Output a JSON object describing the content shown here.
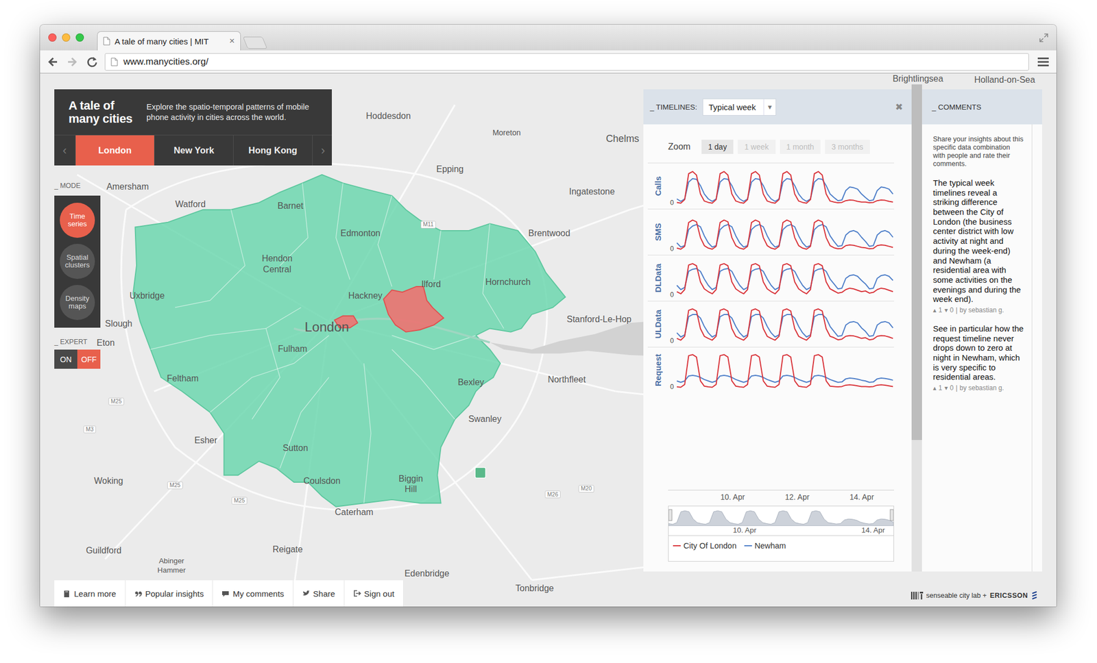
{
  "browser": {
    "tab": {
      "title": "A tale of many cities | MIT",
      "close": "×",
      "selected": true
    },
    "url": "www.manycities.org/"
  },
  "header": {
    "title": "A tale of many cities",
    "description": "Explore the spatio-temporal patterns of mobile phone activity in cities across the world.",
    "prev": "‹",
    "next": "›",
    "cities": [
      {
        "label": "London",
        "selected": true
      },
      {
        "label": "New York",
        "selected": false
      },
      {
        "label": "Hong Kong",
        "selected": false
      }
    ]
  },
  "mode": {
    "label": "_ MODE",
    "items": [
      {
        "label": "Time series",
        "selected": true
      },
      {
        "label": "Spatial clusters",
        "selected": false
      },
      {
        "label": "Density maps",
        "selected": false
      }
    ]
  },
  "expert": {
    "label": "_ EXPERT",
    "options": [
      {
        "label": "ON",
        "selected": false
      },
      {
        "label": "OFF",
        "selected": true
      }
    ]
  },
  "map": {
    "labels": [
      {
        "text": "Brightlingsea",
        "kind": "place"
      },
      {
        "text": "Holland-on-Sea",
        "kind": "place"
      },
      {
        "text": "Hoddesdon",
        "kind": "place"
      },
      {
        "text": "Moreton",
        "kind": "place"
      },
      {
        "text": "Chelms",
        "kind": "place"
      },
      {
        "text": "Epping",
        "kind": "place"
      },
      {
        "text": "Ingatestone",
        "kind": "place"
      },
      {
        "text": "Amersham",
        "kind": "place"
      },
      {
        "text": "Watford",
        "kind": "place"
      },
      {
        "text": "Barnet",
        "kind": "place"
      },
      {
        "text": "Edmonton",
        "kind": "place"
      },
      {
        "text": "Brentwood",
        "kind": "place"
      },
      {
        "text": "Hendon",
        "kind": "place"
      },
      {
        "text": "Central",
        "kind": "place"
      },
      {
        "text": "Hackney",
        "kind": "place"
      },
      {
        "text": "Ilford",
        "kind": "place"
      },
      {
        "text": "Hornchurch",
        "kind": "place"
      },
      {
        "text": "Uxbridge",
        "kind": "place"
      },
      {
        "text": "Slough",
        "kind": "place"
      },
      {
        "text": "London",
        "kind": "city"
      },
      {
        "text": "Stanford-Le-Hop",
        "kind": "place"
      },
      {
        "text": "Eton",
        "kind": "place"
      },
      {
        "text": "Fulham",
        "kind": "place"
      },
      {
        "text": "Feltham",
        "kind": "place"
      },
      {
        "text": "Bexley",
        "kind": "place"
      },
      {
        "text": "Northfleet",
        "kind": "place"
      },
      {
        "text": "Swanley",
        "kind": "place"
      },
      {
        "text": "Esher",
        "kind": "place"
      },
      {
        "text": "Sutton",
        "kind": "place"
      },
      {
        "text": "Woking",
        "kind": "place"
      },
      {
        "text": "Coulsdon",
        "kind": "place"
      },
      {
        "text": "Biggin",
        "kind": "place"
      },
      {
        "text": "Hill",
        "kind": "place"
      },
      {
        "text": "Caterham",
        "kind": "place"
      },
      {
        "text": "Reigate",
        "kind": "place"
      },
      {
        "text": "Guildford",
        "kind": "place"
      },
      {
        "text": "Abinger",
        "kind": "place"
      },
      {
        "text": "Hammer",
        "kind": "place"
      },
      {
        "text": "Edenbridge",
        "kind": "place"
      },
      {
        "text": "Tonbridge",
        "kind": "place"
      },
      {
        "text": "M11",
        "kind": "road"
      },
      {
        "text": "M25",
        "kind": "road"
      },
      {
        "text": "M3",
        "kind": "road"
      },
      {
        "text": "M25",
        "kind": "road"
      },
      {
        "text": "M25",
        "kind": "road"
      },
      {
        "text": "M20",
        "kind": "road"
      },
      {
        "text": "M26",
        "kind": "road"
      }
    ]
  },
  "timelines": {
    "label": "_ TIMELINES:",
    "dropdown": {
      "value": "Typical week",
      "arrow": "▾"
    },
    "close": "✖",
    "zoom": {
      "label": "Zoom",
      "options": [
        {
          "label": "1 day",
          "selected": true,
          "disabled": false
        },
        {
          "label": "1 week",
          "selected": false,
          "disabled": true
        },
        {
          "label": "1 month",
          "selected": false,
          "disabled": true
        },
        {
          "label": "3 months",
          "selected": false,
          "disabled": true
        }
      ]
    },
    "y_tick": "0",
    "charts": [
      {
        "metric": "Calls",
        "values": [
          [
            4,
            2,
            12,
            86,
            92,
            82,
            28,
            8,
            4,
            2,
            12,
            86,
            92,
            82,
            28,
            8,
            4,
            2,
            12,
            86,
            92,
            82,
            28,
            8,
            4,
            2,
            12,
            86,
            92,
            82,
            28,
            8,
            4,
            2,
            12,
            86,
            92,
            82,
            28,
            8,
            5,
            3,
            4,
            9,
            11,
            10,
            7,
            5,
            5,
            3,
            4,
            9,
            11,
            10,
            7,
            5
          ],
          [
            14,
            7,
            14,
            62,
            72,
            70,
            52,
            28,
            14,
            7,
            14,
            62,
            72,
            70,
            52,
            28,
            14,
            7,
            14,
            62,
            72,
            70,
            52,
            28,
            14,
            7,
            14,
            62,
            72,
            70,
            52,
            28,
            14,
            7,
            14,
            62,
            72,
            70,
            52,
            28,
            18,
            9,
            11,
            38,
            48,
            46,
            42,
            28,
            18,
            9,
            11,
            38,
            48,
            46,
            42,
            28
          ]
        ]
      },
      {
        "metric": "SMS",
        "values": [
          [
            5,
            2,
            10,
            78,
            85,
            80,
            35,
            12,
            5,
            2,
            10,
            78,
            85,
            80,
            35,
            12,
            5,
            2,
            10,
            78,
            85,
            80,
            35,
            12,
            5,
            2,
            10,
            78,
            85,
            80,
            35,
            12,
            5,
            2,
            10,
            78,
            85,
            80,
            35,
            12,
            6,
            3,
            4,
            12,
            14,
            13,
            10,
            7,
            6,
            3,
            4,
            12,
            14,
            13,
            10,
            7
          ],
          [
            20,
            8,
            12,
            58,
            68,
            72,
            66,
            40,
            20,
            8,
            12,
            58,
            68,
            72,
            66,
            40,
            20,
            8,
            12,
            58,
            68,
            72,
            66,
            40,
            20,
            8,
            12,
            58,
            68,
            72,
            66,
            40,
            20,
            8,
            12,
            58,
            68,
            72,
            66,
            40,
            24,
            10,
            12,
            42,
            52,
            55,
            50,
            36,
            24,
            10,
            12,
            42,
            52,
            55,
            50,
            36
          ]
        ]
      },
      {
        "metric": "DLData",
        "values": [
          [
            12,
            6,
            18,
            88,
            92,
            86,
            40,
            20,
            12,
            6,
            18,
            88,
            92,
            86,
            40,
            20,
            12,
            6,
            18,
            88,
            92,
            86,
            40,
            20,
            12,
            6,
            18,
            88,
            92,
            86,
            40,
            20,
            12,
            6,
            18,
            88,
            92,
            86,
            40,
            20,
            14,
            8,
            10,
            18,
            22,
            20,
            16,
            12,
            14,
            8,
            10,
            18,
            22,
            20,
            16,
            12
          ],
          [
            30,
            18,
            24,
            70,
            76,
            78,
            70,
            48,
            30,
            18,
            24,
            70,
            76,
            78,
            70,
            48,
            30,
            18,
            24,
            70,
            76,
            78,
            70,
            48,
            30,
            18,
            24,
            70,
            76,
            78,
            70,
            48,
            30,
            18,
            24,
            70,
            76,
            78,
            70,
            48,
            34,
            20,
            22,
            50,
            58,
            60,
            56,
            44,
            34,
            20,
            22,
            50,
            58,
            60,
            56,
            44
          ]
        ]
      },
      {
        "metric": "ULData",
        "values": [
          [
            10,
            5,
            16,
            90,
            94,
            88,
            38,
            16,
            10,
            5,
            16,
            90,
            94,
            88,
            38,
            16,
            10,
            5,
            16,
            90,
            94,
            88,
            38,
            16,
            10,
            5,
            16,
            90,
            94,
            88,
            38,
            16,
            10,
            5,
            16,
            90,
            94,
            88,
            38,
            16,
            12,
            6,
            8,
            16,
            18,
            17,
            14,
            10,
            12,
            6,
            8,
            16,
            18,
            17,
            14,
            10
          ],
          [
            26,
            14,
            20,
            72,
            78,
            78,
            68,
            44,
            26,
            14,
            20,
            72,
            78,
            78,
            68,
            44,
            26,
            14,
            20,
            72,
            78,
            78,
            68,
            44,
            26,
            14,
            20,
            72,
            78,
            78,
            68,
            44,
            26,
            14,
            20,
            72,
            78,
            78,
            68,
            44,
            30,
            16,
            18,
            48,
            56,
            58,
            54,
            40,
            30,
            16,
            18,
            48,
            56,
            58,
            54,
            40
          ]
        ]
      },
      {
        "metric": "Request",
        "values": [
          [
            3,
            2,
            10,
            92,
            95,
            88,
            20,
            5,
            3,
            2,
            10,
            92,
            95,
            88,
            20,
            5,
            3,
            2,
            10,
            92,
            95,
            88,
            20,
            5,
            3,
            2,
            10,
            92,
            95,
            88,
            20,
            5,
            3,
            2,
            10,
            92,
            95,
            88,
            20,
            5,
            4,
            3,
            4,
            8,
            9,
            8,
            6,
            4,
            4,
            3,
            4,
            8,
            9,
            8,
            6,
            4
          ],
          [
            20,
            16,
            20,
            34,
            36,
            34,
            30,
            24,
            20,
            16,
            20,
            34,
            36,
            34,
            30,
            24,
            20,
            16,
            20,
            34,
            36,
            34,
            30,
            24,
            20,
            16,
            20,
            34,
            36,
            34,
            30,
            24,
            20,
            16,
            20,
            34,
            36,
            34,
            30,
            24,
            20,
            16,
            17,
            26,
            28,
            27,
            25,
            22,
            20,
            16,
            17,
            26,
            28,
            27,
            25,
            22
          ]
        ]
      }
    ],
    "x_ticks": [
      "10. Apr",
      "12. Apr",
      "14. Apr"
    ],
    "navigator": {
      "values": [
        8,
        4,
        14,
        80,
        86,
        80,
        36,
        14,
        8,
        4,
        14,
        80,
        86,
        80,
        36,
        14,
        8,
        4,
        14,
        80,
        86,
        80,
        36,
        14,
        8,
        4,
        14,
        80,
        86,
        80,
        36,
        14,
        8,
        4,
        14,
        80,
        86,
        80,
        36,
        14,
        10,
        6,
        8,
        30,
        36,
        34,
        28,
        16,
        10,
        6,
        8,
        30,
        36,
        34,
        28,
        16
      ],
      "ticks": [
        "10. Apr",
        "14. Apr"
      ]
    },
    "legend": [
      {
        "label": "City Of London",
        "color": "#d9343a",
        "highlighted_on_map": true
      },
      {
        "label": "Newham",
        "color": "#4f7fc9",
        "highlighted_on_map": true
      }
    ]
  },
  "comments": {
    "label": "_ COMMENTS",
    "intro": "Share your insights about this specific data combination with people and rate their comments.",
    "items": [
      {
        "text": "The typical week timelines reveal a striking difference between the City of London (the business center district with low activity at night and during the week-end) and Newham (a residential area with some activities on the evenings and during the week end).",
        "up_icon": "▴",
        "up": "1",
        "down_icon": "▾",
        "down": "0",
        "separator": "|",
        "author": "by sebastian g."
      },
      {
        "text": "See in particular how the request timeline never drops down to zero at night in Newham, which is very specific to residential areas.",
        "up_icon": "▴",
        "up": "1",
        "down_icon": "▾",
        "down": "0",
        "separator": "|",
        "author": "by sebastian g."
      }
    ]
  },
  "footer": {
    "buttons": [
      {
        "label": "Learn more"
      },
      {
        "label": "Popular insights"
      },
      {
        "label": "My comments"
      },
      {
        "label": "Share"
      },
      {
        "label": "Sign out"
      }
    ],
    "logo": {
      "lab": "senseable city lab +",
      "partner": "ERICSSON"
    }
  }
}
